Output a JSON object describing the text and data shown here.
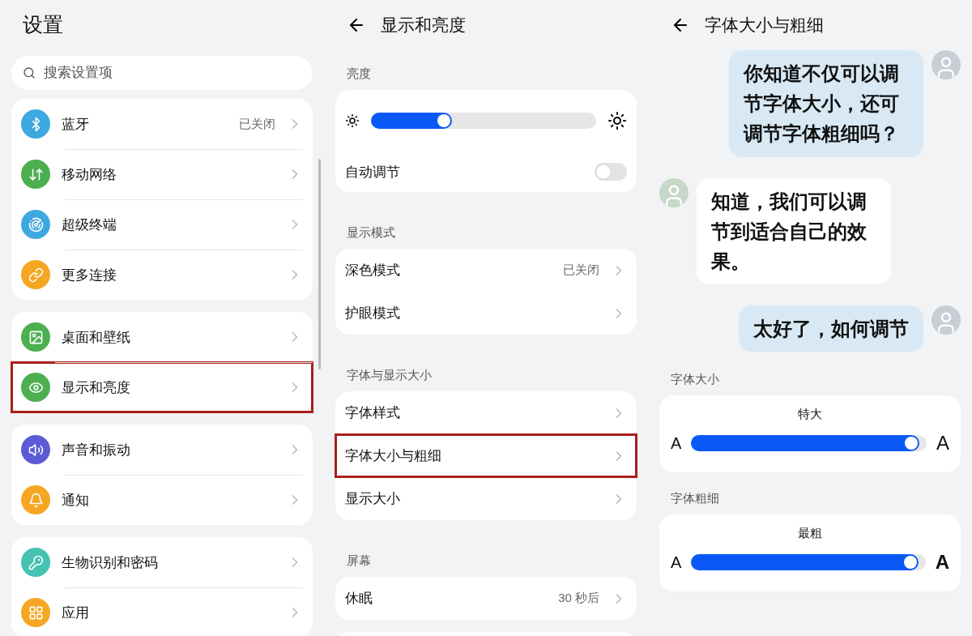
{
  "settings": {
    "title": "设置",
    "search": {
      "placeholder": "搜索设置项"
    },
    "groups": [
      {
        "items": [
          {
            "label": "蓝牙",
            "value": "已关闭",
            "color": "#3ea8e0",
            "highlighted": false
          },
          {
            "label": "移动网络",
            "color": "#4caf50",
            "highlighted": false
          },
          {
            "label": "超级终端",
            "color": "#3ea8e0",
            "highlighted": false
          },
          {
            "label": "更多连接",
            "color": "#f5a623",
            "highlighted": false
          }
        ]
      },
      {
        "items": [
          {
            "label": "桌面和壁纸",
            "color": "#4caf50",
            "highlighted": false
          },
          {
            "label": "显示和亮度",
            "color": "#4caf50",
            "highlighted": true
          }
        ]
      },
      {
        "items": [
          {
            "label": "声音和振动",
            "color": "#5b5bd6",
            "highlighted": false
          },
          {
            "label": "通知",
            "color": "#f5a623",
            "highlighted": false
          }
        ]
      },
      {
        "items": [
          {
            "label": "生物识别和密码",
            "color": "#45c2b0",
            "highlighted": false
          },
          {
            "label": "应用",
            "color": "#f5a623",
            "highlighted": false
          }
        ]
      }
    ]
  },
  "display": {
    "title": "显示和亮度",
    "brightness": {
      "heading": "亮度",
      "level": 0.36,
      "auto_label": "自动调节",
      "auto_on": false
    },
    "sections": [
      {
        "heading": "显示模式",
        "items": [
          {
            "label": "深色模式",
            "value": "已关闭",
            "highlighted": false
          },
          {
            "label": "护眼模式",
            "highlighted": false
          }
        ]
      },
      {
        "heading": "字体与显示大小",
        "items": [
          {
            "label": "字体样式",
            "highlighted": false
          },
          {
            "label": "字体大小与粗细",
            "highlighted": true
          },
          {
            "label": "显示大小",
            "highlighted": false
          }
        ]
      },
      {
        "heading": "屏幕",
        "items": [
          {
            "label": "休眠",
            "value": "30 秒后",
            "highlighted": false
          }
        ]
      }
    ]
  },
  "font": {
    "title": "字体大小与粗细",
    "messages": [
      {
        "kind": "sent",
        "text": "你知道不仅可以调节字体大小，还可调节字体粗细吗？"
      },
      {
        "kind": "received",
        "text": "知道，我们可以调节到适合自己的效果。"
      },
      {
        "kind": "sent",
        "text": "太好了，如何调节"
      }
    ],
    "size": {
      "heading": "字体大小",
      "reading": "特大",
      "level": 0.97,
      "small": "A",
      "large": "A"
    },
    "weight": {
      "heading": "字体粗细",
      "reading": "最粗",
      "level": 0.97,
      "small": "A",
      "large": "A"
    }
  }
}
